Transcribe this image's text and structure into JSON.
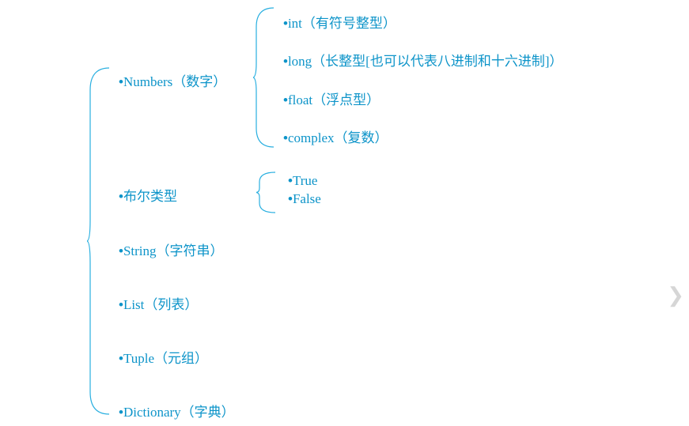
{
  "categories": [
    {
      "label": "Numbers（数字）"
    },
    {
      "label": "布尔类型"
    },
    {
      "label": "String（字符串）"
    },
    {
      "label": "List（列表）"
    },
    {
      "label": "Tuple（元组）"
    },
    {
      "label": "Dictionary（字典）"
    }
  ],
  "numbers_children": [
    {
      "label": "int（有符号整型）"
    },
    {
      "label": "long（长整型[也可以代表八进制和十六进制]）"
    },
    {
      "label": "float（浮点型）"
    },
    {
      "label": "complex（复数）"
    }
  ],
  "boolean_children": [
    {
      "label": "True"
    },
    {
      "label": "False"
    }
  ],
  "bullet": "•",
  "nav": {
    "next": "❯"
  }
}
